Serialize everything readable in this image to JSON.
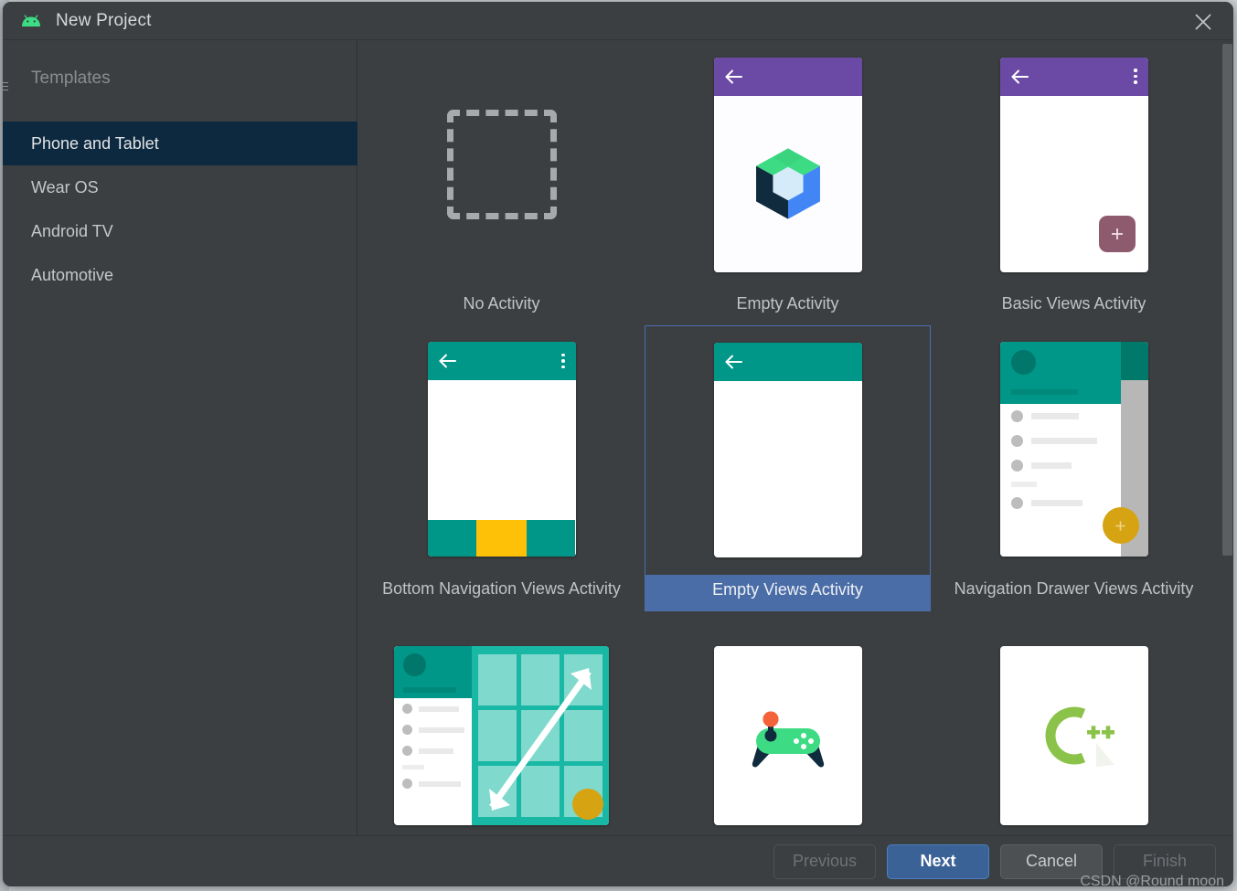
{
  "window": {
    "title": "New Project",
    "app_icon": "android-icon",
    "close_icon": "close-icon"
  },
  "sidebar": {
    "heading": "Templates",
    "items": [
      {
        "label": "Phone and Tablet",
        "selected": true
      },
      {
        "label": "Wear OS",
        "selected": false
      },
      {
        "label": "Android TV",
        "selected": false
      },
      {
        "label": "Automotive",
        "selected": false
      }
    ]
  },
  "templates": {
    "selected": "Empty Views Activity",
    "rows": [
      [
        {
          "label": "No Activity",
          "art": "dashed-square"
        },
        {
          "label": "Empty Activity",
          "art": "compose-phone"
        },
        {
          "label": "Basic Views Activity",
          "art": "basic-views-phone"
        }
      ],
      [
        {
          "label": "Bottom Navigation Views Activity",
          "art": "bottom-nav-phone"
        },
        {
          "label": "Empty Views Activity",
          "art": "empty-views-phone"
        },
        {
          "label": "Navigation Drawer Views Activity",
          "art": "nav-drawer-phone"
        }
      ],
      [
        {
          "label": "",
          "art": "responsive-views-card"
        },
        {
          "label": "",
          "art": "game-activity-card"
        },
        {
          "label": "",
          "art": "native-cpp-card"
        }
      ]
    ]
  },
  "footer": {
    "buttons": [
      {
        "label": "Previous",
        "state": "disabled"
      },
      {
        "label": "Next",
        "state": "primary"
      },
      {
        "label": "Cancel",
        "state": "normal"
      },
      {
        "label": "Finish",
        "state": "disabled"
      }
    ]
  },
  "watermark": {
    "text": "CSDN @Round moon"
  },
  "colors": {
    "dialog_bg": "#3c3f41",
    "sidebar_selected": "#0d293f",
    "accent_blue": "#4a6da7",
    "primary_button": "#3b6296",
    "appbar_purple": "#6b4aa6",
    "appbar_teal": "#009688",
    "fab_mauve": "#8e5a6e",
    "fab_amber": "#d6a312",
    "bottomnav_amber": "#ffc107"
  }
}
